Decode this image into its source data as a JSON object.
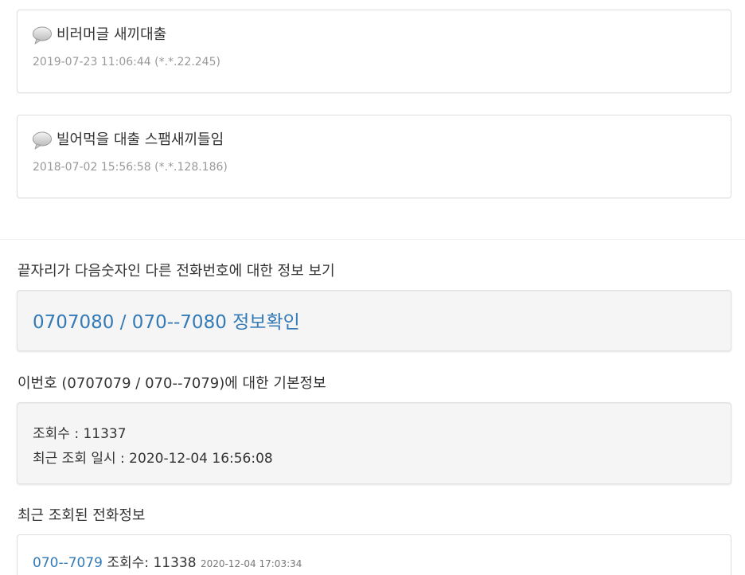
{
  "comments": [
    {
      "text": "비러머글 새끼대출",
      "meta": "2019-07-23 11:06:44 (*.*.22.245)"
    },
    {
      "text": "빌어먹을 대출 스팸새끼들임",
      "meta": "2018-07-02 15:56:58 (*.*.128.186)"
    }
  ],
  "similar": {
    "heading": "끝자리가 다음숫자인 다른 전화번호에 대한 정보 보기",
    "link": "0707080 / 070--7080 정보확인"
  },
  "basic_info": {
    "heading": "이번호 (0707079 / 070--7079)에 대한 기본정보",
    "views": "조회수 : 11337",
    "last_viewed": "최근 조회 일시 : 2020-12-04 16:56:08"
  },
  "recent": {
    "heading": "최근 조회된 전화정보",
    "items": [
      {
        "number": "070--7079",
        "count": "조회수: 11338",
        "time": "2020-12-04 17:03:34"
      }
    ]
  },
  "colors": {
    "link": "#337ab7",
    "meta": "#999999",
    "well_bg": "#f5f5f5"
  },
  "icons": {
    "comment": "speech-bubble-icon"
  }
}
